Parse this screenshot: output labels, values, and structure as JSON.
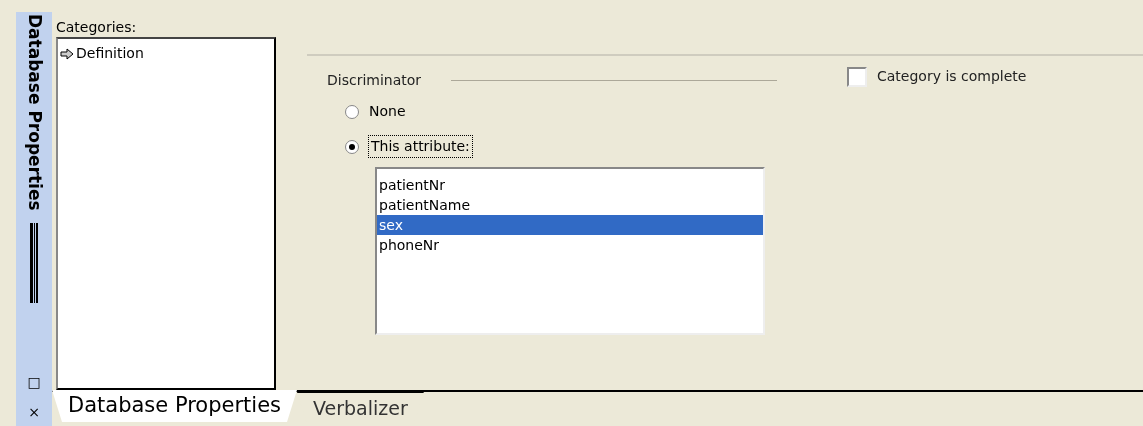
{
  "side_panel": {
    "title": "Database Properties",
    "buttons": [
      "□",
      "×"
    ]
  },
  "categories": {
    "label": "Categories:",
    "items": [
      {
        "label": "Definition",
        "selected": true
      }
    ]
  },
  "discriminator": {
    "title": "Discriminator",
    "options": [
      {
        "label": "None",
        "selected": false
      },
      {
        "label": "This attribute:",
        "selected": true
      }
    ],
    "attributes": [
      {
        "label": "patientNr",
        "selected": false
      },
      {
        "label": "patientName",
        "selected": false
      },
      {
        "label": "sex",
        "selected": true
      },
      {
        "label": "phoneNr",
        "selected": false
      }
    ]
  },
  "category_complete": {
    "label": "Category is complete",
    "checked": false
  },
  "tabs": [
    {
      "label": "Database Properties",
      "selected": true
    },
    {
      "label": "Verbalizer",
      "selected": false
    }
  ]
}
